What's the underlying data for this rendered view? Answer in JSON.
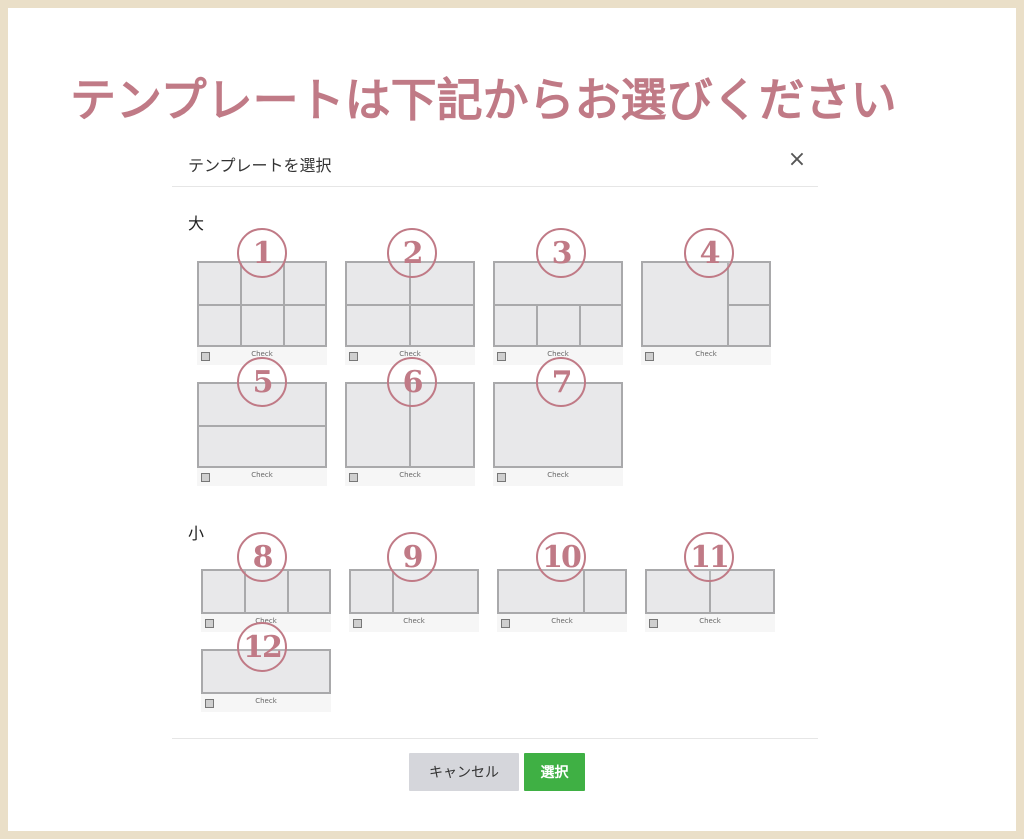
{
  "heading": "テンプレートは下記からお選びください",
  "modal": {
    "title": "テンプレートを選択",
    "close_label": "×"
  },
  "sections": {
    "large_label": "大",
    "small_label": "小"
  },
  "templates": [
    {
      "number": "1",
      "check_label": "Check"
    },
    {
      "number": "2",
      "check_label": "Check"
    },
    {
      "number": "3",
      "check_label": "Check"
    },
    {
      "number": "4",
      "check_label": "Check"
    },
    {
      "number": "5",
      "check_label": "Check"
    },
    {
      "number": "6",
      "check_label": "Check"
    },
    {
      "number": "7",
      "check_label": "Check"
    },
    {
      "number": "8",
      "check_label": "Check"
    },
    {
      "number": "9",
      "check_label": "Check"
    },
    {
      "number": "10",
      "check_label": "Check"
    },
    {
      "number": "11",
      "check_label": "Check"
    },
    {
      "number": "12",
      "check_label": "Check"
    }
  ],
  "footer": {
    "cancel_label": "キャンセル",
    "select_label": "選択"
  },
  "colors": {
    "accent": "#c07a86",
    "frame": "#eadfc8",
    "select_button": "#3fb044",
    "cancel_button": "#d5d6db"
  },
  "icons": {
    "close": "close-icon",
    "checkbox": "checkbox-icon"
  }
}
